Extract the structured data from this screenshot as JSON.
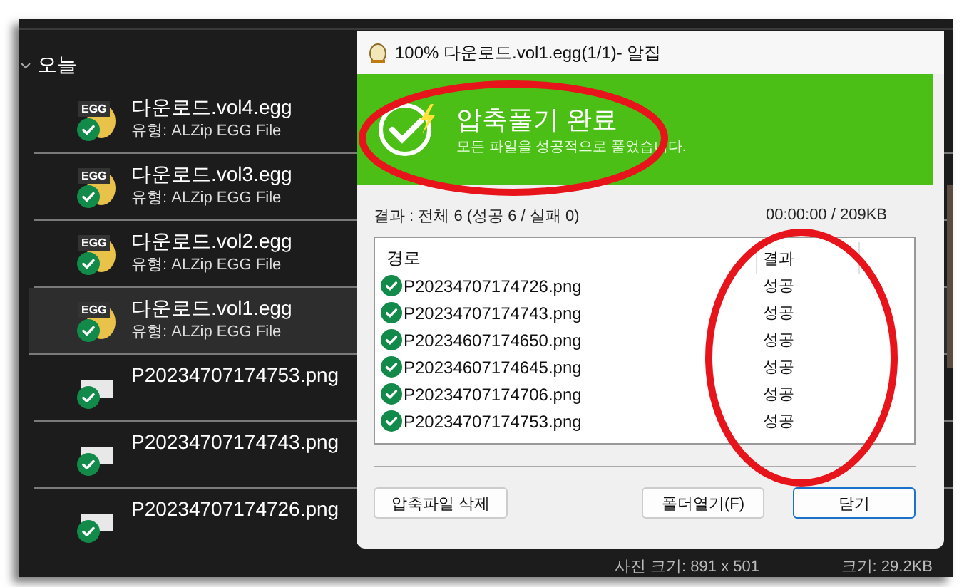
{
  "explorer": {
    "group": {
      "label": "오늘",
      "expanded": true
    },
    "items": [
      {
        "kind": "egg",
        "icon_label": "EGG",
        "name": "다운로드.vol4.egg",
        "type": "유형: ALZip EGG File",
        "selected": false
      },
      {
        "kind": "egg",
        "icon_label": "EGG",
        "name": "다운로드.vol3.egg",
        "type": "유형: ALZip EGG File",
        "selected": false
      },
      {
        "kind": "egg",
        "icon_label": "EGG",
        "name": "다운로드.vol2.egg",
        "type": "유형: ALZip EGG File",
        "selected": false
      },
      {
        "kind": "egg",
        "icon_label": "EGG",
        "name": "다운로드.vol1.egg",
        "type": "유형: ALZip EGG File",
        "selected": true
      },
      {
        "kind": "png",
        "name": "P20234707174753.png",
        "selected": false
      },
      {
        "kind": "png",
        "name": "P20234707174743.png",
        "selected": false
      },
      {
        "kind": "png",
        "name": "P20234707174726.png",
        "selected": false
      }
    ],
    "details": [
      "사진 크기: 891 x 501",
      "크기: 29.2KB"
    ]
  },
  "dialog": {
    "title": "100% 다운로드.vol1.egg(1/1)- 알집",
    "banner": {
      "title": "압축풀기 완료",
      "subtitle": "모든 파일을 성공적으로 풀었습니다."
    },
    "summary": "결과 : 전체 6 (성공 6 / 실패 0)",
    "progress": "00:00:00 / 209KB",
    "list": {
      "columns": [
        "경로",
        "결과"
      ],
      "rows": [
        {
          "path": "P20234707174726.png",
          "result": "성공"
        },
        {
          "path": "P20234707174743.png",
          "result": "성공"
        },
        {
          "path": "P20234607174650.png",
          "result": "성공"
        },
        {
          "path": "P20234607174645.png",
          "result": "성공"
        },
        {
          "path": "P20234707174706.png",
          "result": "성공"
        },
        {
          "path": "P20234707174753.png",
          "result": "성공"
        }
      ]
    },
    "buttons": [
      {
        "label": "압축파일 삭제",
        "default": false
      },
      {
        "label": "폴더열기(F)",
        "default": false
      },
      {
        "label": "닫기",
        "default": true
      }
    ]
  }
}
